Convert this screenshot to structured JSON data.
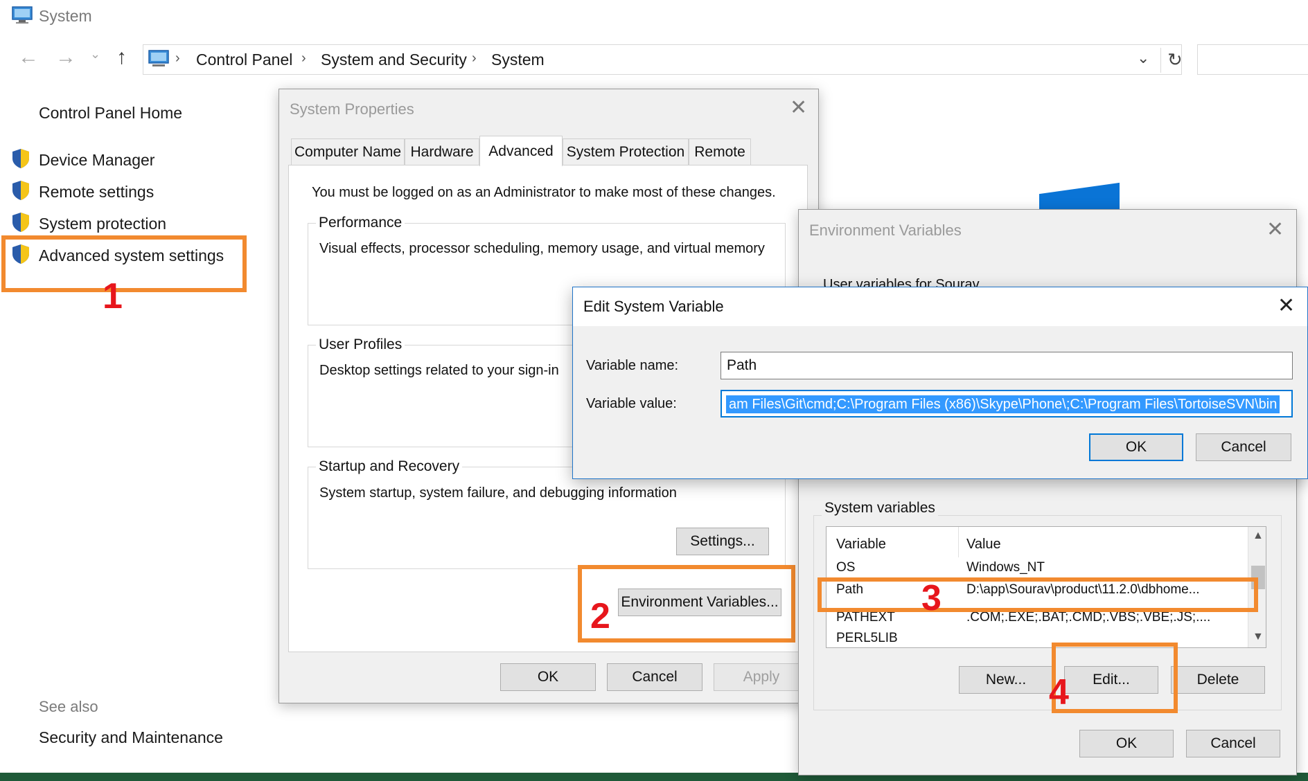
{
  "window": {
    "title": "System",
    "breadcrumb": [
      "Control Panel",
      "System and Security",
      "System"
    ]
  },
  "left_pane": {
    "home": "Control Panel Home",
    "links": [
      "Device Manager",
      "Remote settings",
      "System protection",
      "Advanced system settings"
    ],
    "see_also_heading": "See also",
    "see_also_links": [
      "Security and Maintenance"
    ]
  },
  "annotations": {
    "n1": "1",
    "n2": "2",
    "n3": "3",
    "n4": "4",
    "color": "#f28a2f",
    "number_color": "#e7161c"
  },
  "system_properties": {
    "title": "System Properties",
    "tabs": [
      "Computer Name",
      "Hardware",
      "Advanced",
      "System Protection",
      "Remote"
    ],
    "active_tab": "Advanced",
    "admin_note": "You must be logged on as an Administrator to make most of these changes.",
    "performance": {
      "legend": "Performance",
      "desc": "Visual effects, processor scheduling, memory usage, and virtual memory"
    },
    "user_profiles": {
      "legend": "User Profiles",
      "desc": "Desktop settings related to your sign-in"
    },
    "startup": {
      "legend": "Startup and Recovery",
      "desc": "System startup, system failure, and debugging information",
      "settings_button": "Settings..."
    },
    "env_button": "Environment Variables...",
    "ok": "OK",
    "cancel": "Cancel",
    "apply": "Apply"
  },
  "env_vars": {
    "title": "Environment Variables",
    "user_section": "User variables for Sourav",
    "system_section": "System variables",
    "columns": [
      "Variable",
      "Value"
    ],
    "rows": [
      {
        "variable": "OS",
        "value": "Windows_NT"
      },
      {
        "variable": "Path",
        "value": "D:\\app\\Sourav\\product\\11.2.0\\dbhome..."
      },
      {
        "variable": "PATHEXT",
        "value": ".COM;.EXE;.BAT;.CMD;.VBS;.VBE;.JS;...."
      },
      {
        "variable": "PERL5LIB",
        "value": ""
      }
    ],
    "new_button": "New...",
    "edit_button": "Edit...",
    "delete_button": "Delete",
    "ok": "OK",
    "cancel": "Cancel"
  },
  "edit_var": {
    "title": "Edit System Variable",
    "name_label": "Variable name:",
    "name_value": "Path",
    "value_label": "Variable value:",
    "value_value": "am Files\\Git\\cmd;C:\\Program Files (x86)\\Skype\\Phone\\;C:\\Program Files\\TortoiseSVN\\bin",
    "ok": "OK",
    "cancel": "Cancel"
  }
}
